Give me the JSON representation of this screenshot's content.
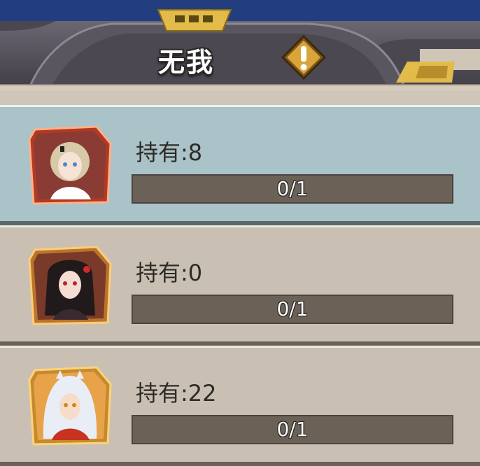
{
  "header": {
    "title": "无我"
  },
  "items": [
    {
      "owned_text": "持有:8",
      "progress_text": "0/1",
      "progress": 0,
      "selected": true,
      "character": "blonde-maid-girl"
    },
    {
      "owned_text": "持有:0",
      "progress_text": "0/1",
      "progress": 0,
      "selected": false,
      "character": "black-hair-shrine-girl"
    },
    {
      "owned_text": "持有:22",
      "progress_text": "0/1",
      "progress": 0,
      "selected": false,
      "character": "white-hair-dog-demon"
    }
  ],
  "icons": {
    "warning": "exclamation-icon"
  },
  "colors": {
    "selected_row": "#a9c3c8",
    "row": "#c9c0b3",
    "bar": "#6b6157",
    "accent_gold": "#e2bb4a"
  }
}
